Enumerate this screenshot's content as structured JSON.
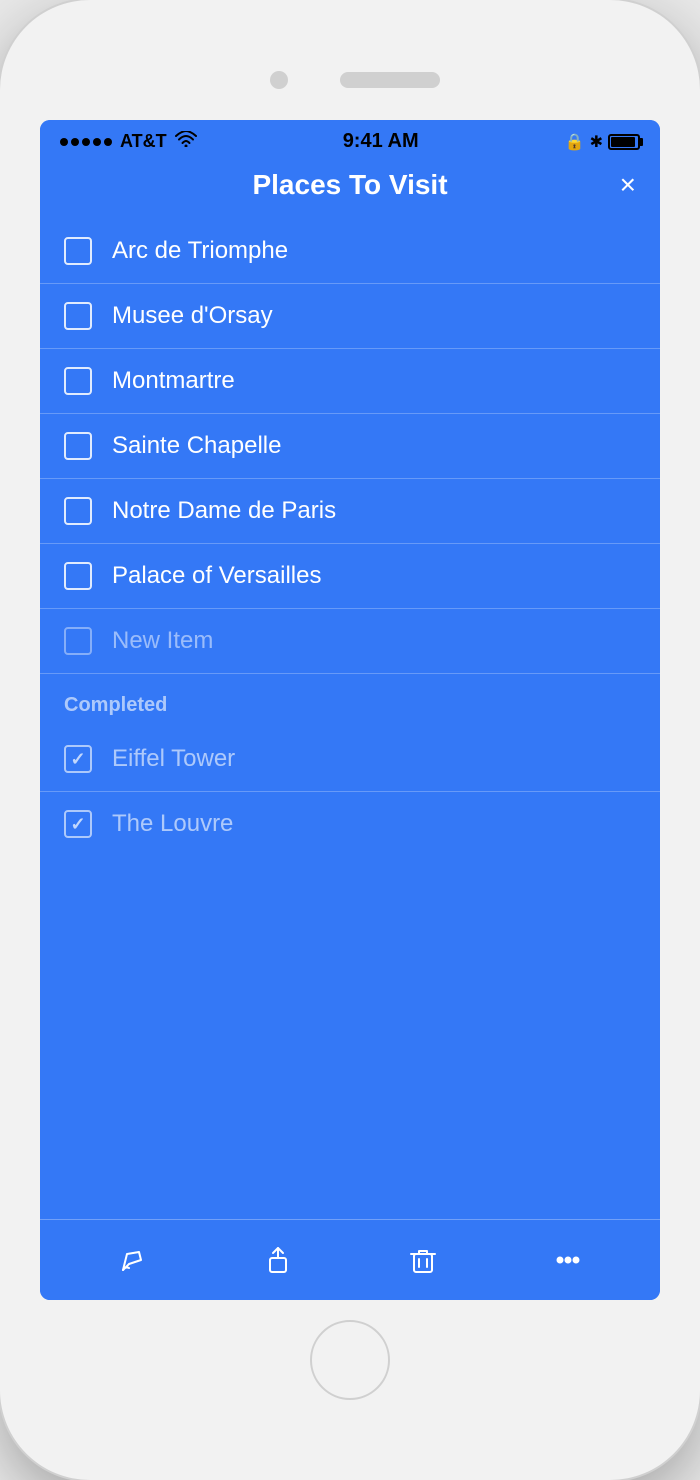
{
  "status_bar": {
    "carrier": "AT&T",
    "time": "9:41 AM",
    "signal_dots": 5
  },
  "header": {
    "title": "Places To Visit",
    "close_label": "×"
  },
  "list_items": [
    {
      "id": 1,
      "text": "Arc de Triomphe",
      "checked": false,
      "placeholder": false
    },
    {
      "id": 2,
      "text": "Musee d'Orsay",
      "checked": false,
      "placeholder": false
    },
    {
      "id": 3,
      "text": "Montmartre",
      "checked": false,
      "placeholder": false
    },
    {
      "id": 4,
      "text": "Sainte Chapelle",
      "checked": false,
      "placeholder": false
    },
    {
      "id": 5,
      "text": "Notre Dame de Paris",
      "checked": false,
      "placeholder": false
    },
    {
      "id": 6,
      "text": "Palace of Versailles",
      "checked": false,
      "placeholder": false
    },
    {
      "id": 7,
      "text": "New Item",
      "checked": false,
      "placeholder": true
    }
  ],
  "completed_section": {
    "label": "Completed",
    "items": [
      {
        "id": 8,
        "text": "Eiffel Tower",
        "checked": true
      },
      {
        "id": 9,
        "text": "The Louvre",
        "checked": true
      }
    ]
  },
  "toolbar": {
    "paint_label": "paint",
    "share_label": "share",
    "trash_label": "trash",
    "more_label": "more"
  }
}
